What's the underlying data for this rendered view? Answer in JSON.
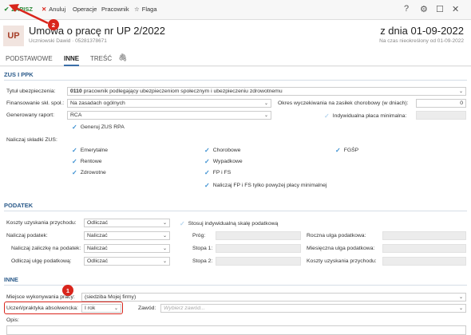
{
  "toolbar": {
    "save": "ZAPISZ",
    "cancel": "Anuluj",
    "operations": "Operacje",
    "employee": "Pracownik",
    "flag": "Flaga",
    "help_icon": "?",
    "gear_icon": "gear-icon",
    "window_icon": "window-icon",
    "close_icon": "close-icon"
  },
  "header": {
    "badge": "UP",
    "title": "Umowa o pracę nr UP 2/2022",
    "subtitle": "Uczniowski Dawid · 05281378671",
    "date_title": "z dnia 01-09-2022",
    "date_sub": "Na czas nieokreślony od 01-09-2022"
  },
  "tabs": [
    "PODSTAWOWE",
    "INNE",
    "TREŚĆ"
  ],
  "zus": {
    "heading": "ZUS I PPK",
    "tytul_label": "Tytuł ubezpieczenia:",
    "tytul_code": "0110",
    "tytul_value": "pracownik podlegający ubezpieczeniom społecznym i ubezpieczeniu zdrowotnemu",
    "finans_label": "Finansowanie skł. społ.:",
    "finans_value": "Na zasadach ogólnych",
    "okres_label": "Okres wyczekiwania na zasiłek chorobowy (w dniach):",
    "okres_value": "0",
    "raport_label": "Generowany raport:",
    "raport_value": "RCA",
    "indyw_label": "Indywidualna płaca minimalna:",
    "generuj_label": "Generuj ZUS RPA",
    "naliczaj_label": "Naliczaj składki ZUS:",
    "chk_emerytalne": "Emerytalne",
    "chk_rentowe": "Rentowe",
    "chk_zdrowotne": "Zdrowotne",
    "chk_chorobowe": "Chorobowe",
    "chk_wypadkowe": "Wypadkowe",
    "chk_fpfs": "FP i FS",
    "chk_fpfs_min": "Naliczaj FP i FS tylko powyżej płacy minimalnej",
    "chk_fgsp": "FGŚP"
  },
  "podatek": {
    "heading": "PODATEK",
    "koszty_label": "Koszty uzyskania przychodu:",
    "koszty_value": "Odliczać",
    "skala_label": "Stosuj indywidualną skalę podatkową",
    "naliczaj_label": "Naliczaj podatek:",
    "naliczaj_value": "Naliczać",
    "prog_label": "Próg:",
    "roczna_label": "Roczna ulga podatkowa:",
    "zaliczke_label": "Naliczaj zaliczkę na podatek:",
    "zaliczke_value": "Naliczać",
    "stopa1_label": "Stopa 1:",
    "miesieczna_label": "Miesięczna ulga podatkowa:",
    "ulge_label": "Odliczaj ulgę podatkową:",
    "ulge_value": "Odliczać",
    "stopa2_label": "Stopa 2:",
    "kup_label": "Koszty uzyskania przychodu:"
  },
  "inne": {
    "heading": "INNE",
    "miejsce_label": "Miejsce wykonywania pracy:",
    "miejsce_value": "(siedziba Mojej firmy)",
    "uczen_label": "Uczeń/praktyka absolwencka:",
    "uczen_value": "I rok",
    "zawod_label": "Zawód:",
    "zawod_placeholder": "Wybierz zawód...",
    "opis_label": "Opis:"
  },
  "callouts": [
    "1",
    "2"
  ],
  "colors": {
    "accent": "#2a5a8a",
    "save": "#2e8b3a",
    "callout": "#d9251c",
    "check": "#3a8fd1"
  }
}
